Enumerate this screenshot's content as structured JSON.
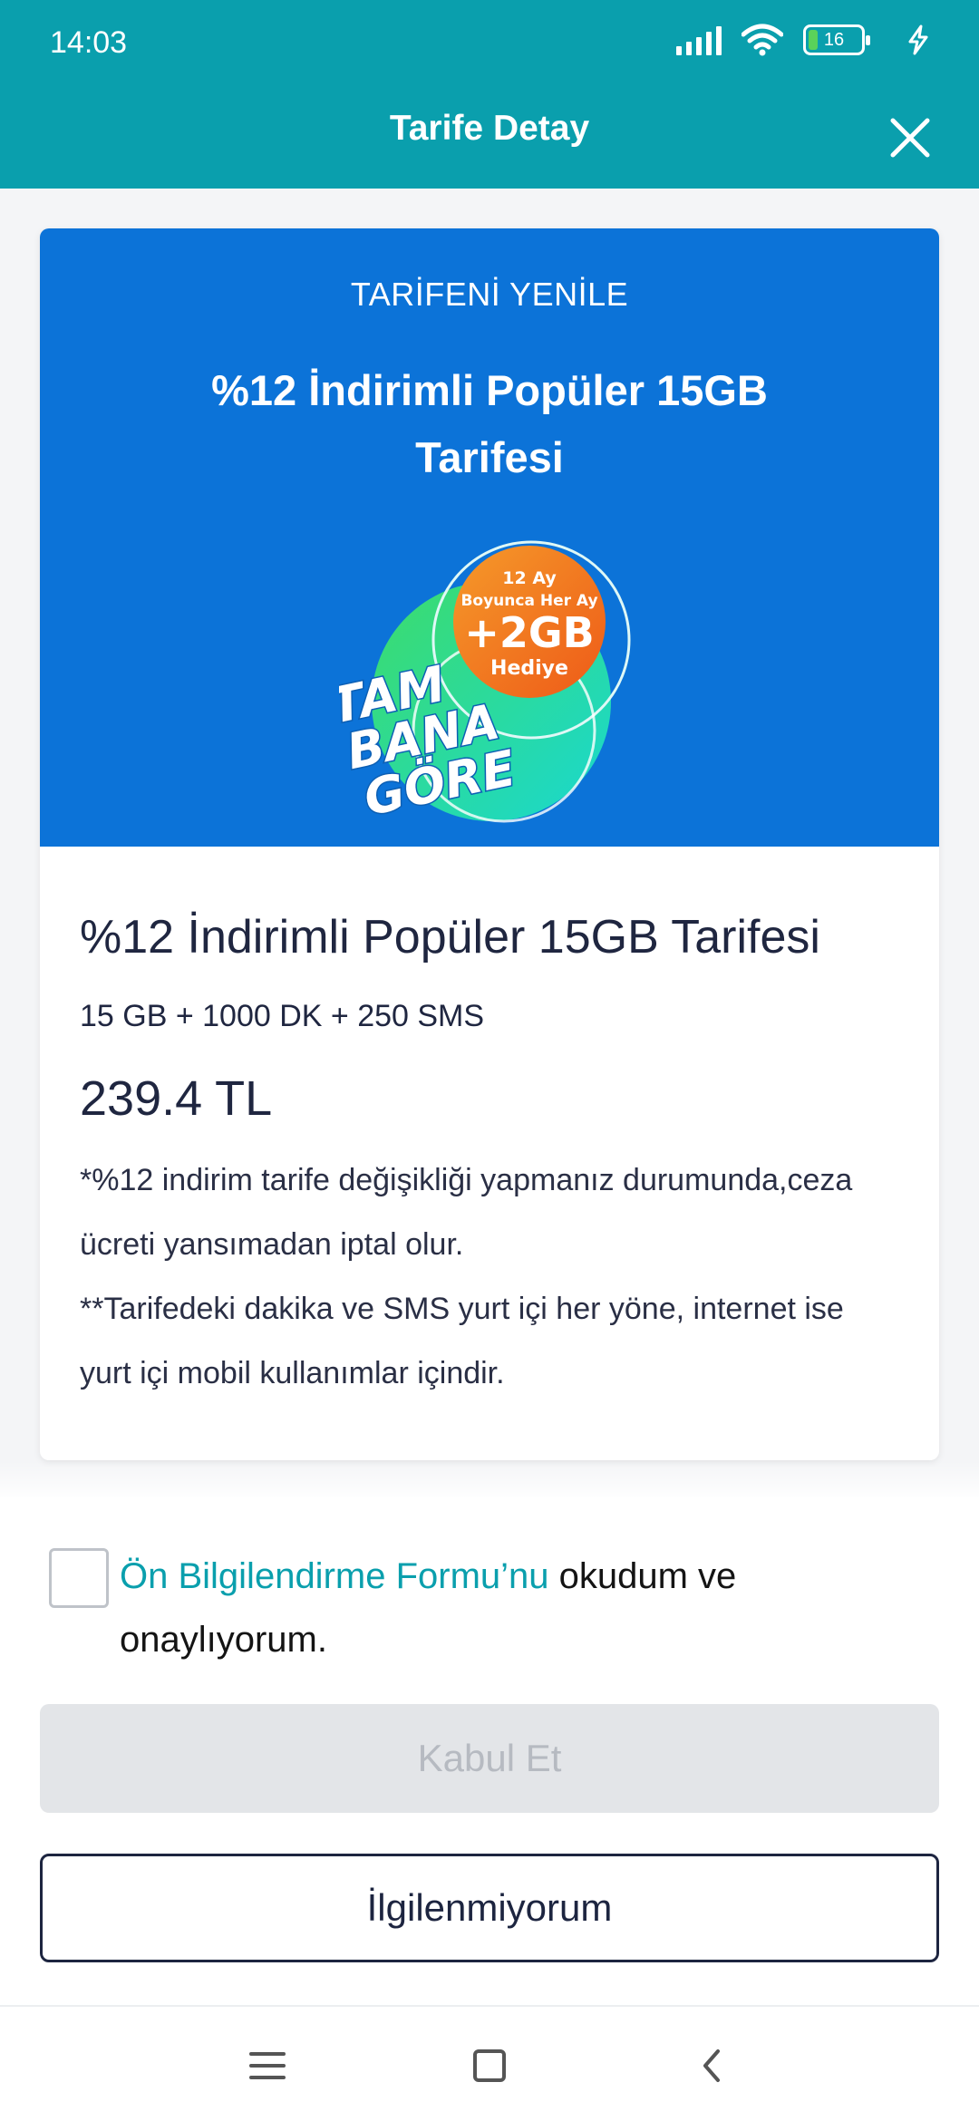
{
  "status_bar": {
    "time": "14:03",
    "battery_percent": "16",
    "icons": [
      "signal-icon",
      "wifi-icon",
      "battery-icon",
      "charging-icon"
    ]
  },
  "header": {
    "title": "Tarife Detay",
    "close_icon": "close-icon"
  },
  "banner": {
    "eyebrow": "TARİFENİ YENİLE",
    "title": "%12 İndirimli Popüler 15GB Tarifesi",
    "badge_line1": "12 Ay",
    "badge_line2": "Boyunca Her Ay",
    "badge_amount": "+2GB",
    "badge_line3": "Hediye",
    "logo_line1": "TAM",
    "logo_line2": "BANA",
    "logo_line3": "GÖRE",
    "colors": {
      "background": "#0c73d8",
      "badge": "#f06a1c",
      "green": "#38d66b",
      "cyan": "#1ed4c8"
    }
  },
  "details": {
    "plan_name": "%12 İndirimli Popüler 15GB Tarifesi",
    "specs": "15 GB + 1000 DK + 250 SMS",
    "price": "239.4 TL",
    "note_line1": "*%12 indirim tarife değişikliği yapmanız durumunda,ceza ücreti yansımadan iptal olur.",
    "note_line2": "**Tarifedeki dakika ve SMS yurt içi her yöne, internet ise yurt içi mobil kullanımlar içindir."
  },
  "consent": {
    "checked": false,
    "link_text": "Ön Bilgilendirme Formu’nu",
    "text": " okudum ve onaylıyorum."
  },
  "buttons": {
    "accept": "Kabul Et",
    "decline": "İlgilenmiyorum"
  },
  "nav": {
    "icons": [
      "menu-icon",
      "home-icon",
      "back-icon"
    ]
  },
  "theme": {
    "primary": "#0a9fad",
    "text_dark": "#1f2640",
    "disabled_bg": "#e3e5e8",
    "disabled_text": "#b6bac1"
  }
}
